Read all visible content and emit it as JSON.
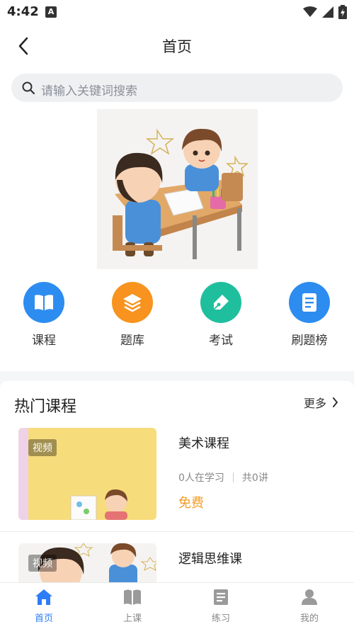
{
  "status": {
    "time": "4:42",
    "notif": "A"
  },
  "header": {
    "title": "首页"
  },
  "search": {
    "placeholder": "请输入关键词搜索"
  },
  "nav": [
    {
      "label": "课程",
      "icon": "book-open-icon",
      "color": "#2d8cf0"
    },
    {
      "label": "题库",
      "icon": "layers-icon",
      "color": "#f7931e"
    },
    {
      "label": "考试",
      "icon": "pen-icon",
      "color": "#1fbf9e"
    },
    {
      "label": "刷题榜",
      "icon": "document-icon",
      "color": "#2d8cf0"
    }
  ],
  "hot": {
    "title": "热门课程",
    "more": "更多",
    "courses": [
      {
        "tag": "视频",
        "title": "美术课程",
        "learners": "0人在学习",
        "lessons": "共0讲",
        "price": "免费"
      },
      {
        "tag": "视频",
        "title": "逻辑思维课"
      }
    ]
  },
  "tabbar": [
    {
      "label": "首页",
      "icon": "home-icon",
      "active": true
    },
    {
      "label": "上课",
      "icon": "book-icon",
      "active": false
    },
    {
      "label": "练习",
      "icon": "notes-icon",
      "active": false
    },
    {
      "label": "我的",
      "icon": "user-icon",
      "active": false
    }
  ],
  "colors": {
    "accent": "#2d7df6",
    "price": "#f39c27"
  }
}
